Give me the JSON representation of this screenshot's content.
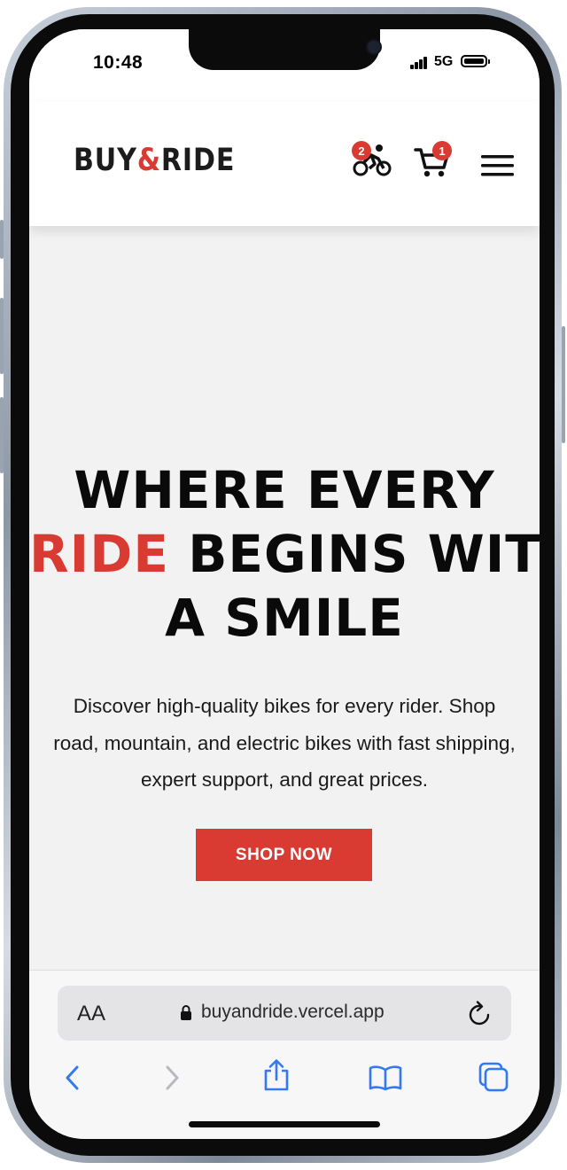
{
  "status": {
    "time": "10:48",
    "network": "5G"
  },
  "header": {
    "logo_left": "BUY",
    "logo_amp": "&",
    "logo_right": "RIDE",
    "compare_count": "2",
    "cart_count": "1"
  },
  "hero": {
    "line1": "WHERE EVERY",
    "line2_accent": "RIDE",
    "line2_rest": " BEGINS WITH",
    "line3": "A SMILE",
    "subtitle": "Discover high-quality bikes for every rider. Shop road, mountain, and electric bikes with fast shipping, expert support, and great prices.",
    "cta": "SHOP NOW"
  },
  "browser": {
    "text_size_label": "AA",
    "url": "buyandride.vercel.app"
  },
  "colors": {
    "accent": "#d93a32",
    "text": "#0a0a0a",
    "hero_bg": "#f2f2f2",
    "safari_blue": "#3478f6"
  }
}
